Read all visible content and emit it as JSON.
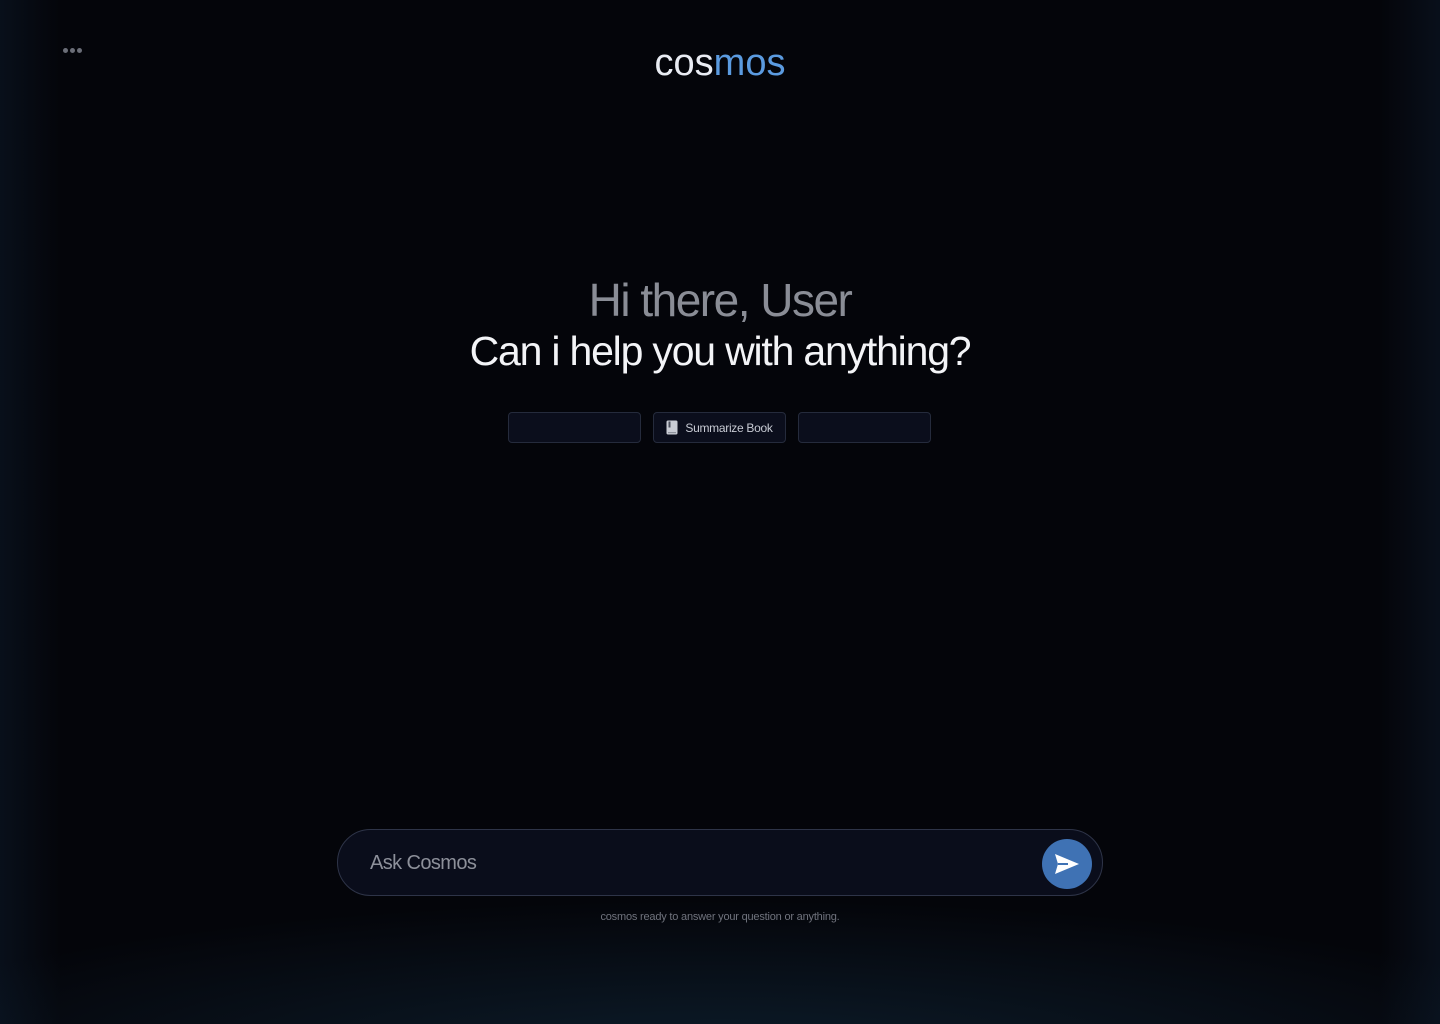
{
  "app": {
    "logo_part_1": "cos",
    "logo_part_2": "mos",
    "menu_icon": "ellipsis-icon"
  },
  "hero": {
    "greeting": "Hi there, User",
    "question": "Can i help you with anything?"
  },
  "suggestions": [
    {
      "label": ""
    },
    {
      "label": "Summarize Book",
      "icon": "book-icon"
    },
    {
      "label": ""
    }
  ],
  "composer": {
    "placeholder": "Ask Cosmos",
    "value": "",
    "send_icon": "send-icon",
    "caption": "cosmos ready to answer your question or anything."
  },
  "colors": {
    "background": "#04050a",
    "accent": "#5b9be0",
    "send_button": "#3f72b4"
  }
}
